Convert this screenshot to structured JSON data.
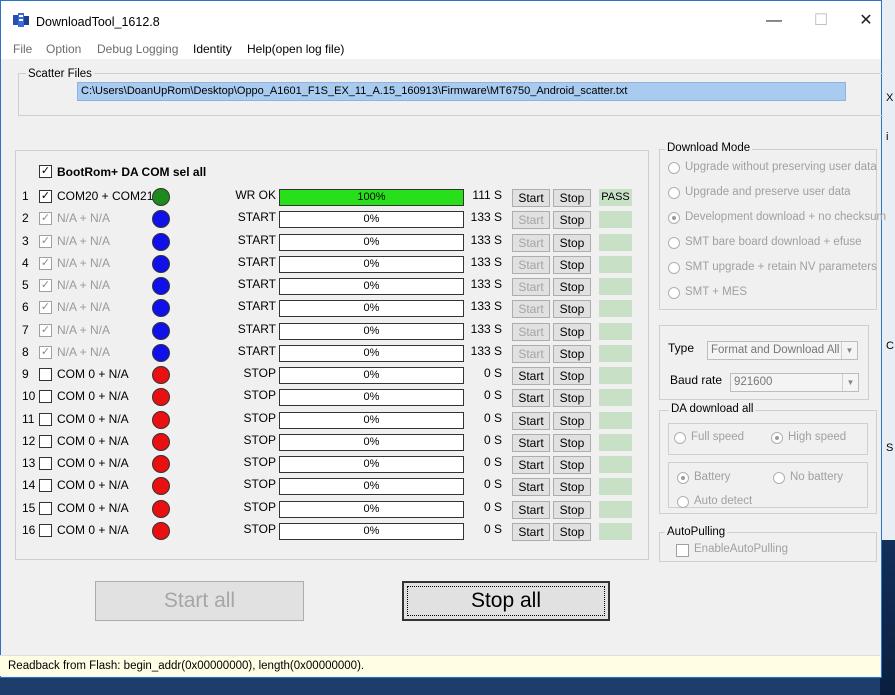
{
  "window": {
    "title": "DownloadTool_1612.8"
  },
  "menu": [
    "File",
    "Option",
    "Debug Logging",
    "Identity",
    "Help(open log file)"
  ],
  "scatter": {
    "label": "Scatter Files",
    "path": "C:\\Users\\DoanUpRom\\Desktop\\Oppo_A1601_F1S_EX_11_A.15_160913\\Firmware\\MT6750_Android_scatter.txt"
  },
  "select_all": {
    "label": "BootRom+ DA COM sel all",
    "checked": true
  },
  "rows": [
    {
      "num": "1",
      "checked": true,
      "enabled": true,
      "port": "COM20 + COM21",
      "led": "#1e8a1e",
      "state": "WR OK",
      "progress": "100%",
      "time": "111 S",
      "start": "Start",
      "stop": "Stop",
      "result": "PASS"
    },
    {
      "num": "2",
      "checked": true,
      "enabled": false,
      "port": "N/A + N/A",
      "led": "#1010e8",
      "state": "START",
      "progress": "0%",
      "time": "133 S",
      "start": "Start",
      "stop": "Stop",
      "result": ""
    },
    {
      "num": "3",
      "checked": true,
      "enabled": false,
      "port": "N/A + N/A",
      "led": "#1010e8",
      "state": "START",
      "progress": "0%",
      "time": "133 S",
      "start": "Start",
      "stop": "Stop",
      "result": ""
    },
    {
      "num": "4",
      "checked": true,
      "enabled": false,
      "port": "N/A + N/A",
      "led": "#1010e8",
      "state": "START",
      "progress": "0%",
      "time": "133 S",
      "start": "Start",
      "stop": "Stop",
      "result": ""
    },
    {
      "num": "5",
      "checked": true,
      "enabled": false,
      "port": "N/A + N/A",
      "led": "#1010e8",
      "state": "START",
      "progress": "0%",
      "time": "133 S",
      "start": "Start",
      "stop": "Stop",
      "result": ""
    },
    {
      "num": "6",
      "checked": true,
      "enabled": false,
      "port": "N/A + N/A",
      "led": "#1010e8",
      "state": "START",
      "progress": "0%",
      "time": "133 S",
      "start": "Start",
      "stop": "Stop",
      "result": ""
    },
    {
      "num": "7",
      "checked": true,
      "enabled": false,
      "port": "N/A + N/A",
      "led": "#1010e8",
      "state": "START",
      "progress": "0%",
      "time": "133 S",
      "start": "Start",
      "stop": "Stop",
      "result": ""
    },
    {
      "num": "8",
      "checked": true,
      "enabled": false,
      "port": "N/A + N/A",
      "led": "#1010e8",
      "state": "START",
      "progress": "0%",
      "time": "133 S",
      "start": "Start",
      "stop": "Stop",
      "result": ""
    },
    {
      "num": "9",
      "checked": false,
      "enabled": true,
      "port": "COM 0 + N/A",
      "led": "#e81010",
      "state": "STOP",
      "progress": "0%",
      "time": "0 S",
      "start": "Start",
      "stop": "Stop",
      "result": ""
    },
    {
      "num": "10",
      "checked": false,
      "enabled": true,
      "port": "COM 0 + N/A",
      "led": "#e81010",
      "state": "STOP",
      "progress": "0%",
      "time": "0 S",
      "start": "Start",
      "stop": "Stop",
      "result": ""
    },
    {
      "num": "11",
      "checked": false,
      "enabled": true,
      "port": "COM 0 + N/A",
      "led": "#e81010",
      "state": "STOP",
      "progress": "0%",
      "time": "0 S",
      "start": "Start",
      "stop": "Stop",
      "result": ""
    },
    {
      "num": "12",
      "checked": false,
      "enabled": true,
      "port": "COM 0 + N/A",
      "led": "#e81010",
      "state": "STOP",
      "progress": "0%",
      "time": "0 S",
      "start": "Start",
      "stop": "Stop",
      "result": ""
    },
    {
      "num": "13",
      "checked": false,
      "enabled": true,
      "port": "COM 0 + N/A",
      "led": "#e81010",
      "state": "STOP",
      "progress": "0%",
      "time": "0 S",
      "start": "Start",
      "stop": "Stop",
      "result": ""
    },
    {
      "num": "14",
      "checked": false,
      "enabled": true,
      "port": "COM 0 + N/A",
      "led": "#e81010",
      "state": "STOP",
      "progress": "0%",
      "time": "0 S",
      "start": "Start",
      "stop": "Stop",
      "result": ""
    },
    {
      "num": "15",
      "checked": false,
      "enabled": true,
      "port": "COM 0 + N/A",
      "led": "#e81010",
      "state": "STOP",
      "progress": "0%",
      "time": "0 S",
      "start": "Start",
      "stop": "Stop",
      "result": ""
    },
    {
      "num": "16",
      "checked": false,
      "enabled": true,
      "port": "COM 0 + N/A",
      "led": "#e81010",
      "state": "STOP",
      "progress": "0%",
      "time": "0 S",
      "start": "Start",
      "stop": "Stop",
      "result": ""
    }
  ],
  "actions": {
    "start_all": "Start all",
    "stop_all": "Stop all"
  },
  "download_mode": {
    "label": "Download Mode",
    "options": [
      {
        "label": "Upgrade without preserving user data",
        "selected": false
      },
      {
        "label": "Upgrade and preserve user data",
        "selected": false
      },
      {
        "label": "Development download + no checksum",
        "selected": true
      },
      {
        "label": "SMT bare board download + efuse",
        "selected": false
      },
      {
        "label": "SMT upgrade + retain NV parameters",
        "selected": false
      },
      {
        "label": "SMT + MES",
        "selected": false
      }
    ]
  },
  "type": {
    "label": "Type",
    "value": "Format and Download All"
  },
  "baud": {
    "label": "Baud rate",
    "value": "921600"
  },
  "da_download": {
    "label": "DA download all",
    "full_speed": "Full speed",
    "high_speed": "High speed",
    "battery": "Battery",
    "no_battery": "No battery",
    "auto_detect": "Auto detect"
  },
  "autopulling": {
    "label": "AutoPulling",
    "checkbox": "EnableAutoPulling"
  },
  "status": "Readback from Flash:  begin_addr(0x00000000), length(0x00000000).",
  "colors": {
    "progress_fill": "#27e01a",
    "result_bg": "#c7e0c6",
    "scatter_bg": "#a9cbf0"
  },
  "progress_values": [
    1,
    0,
    0,
    0,
    0,
    0,
    0,
    0,
    0,
    0,
    0,
    0,
    0,
    0,
    0,
    0
  ]
}
